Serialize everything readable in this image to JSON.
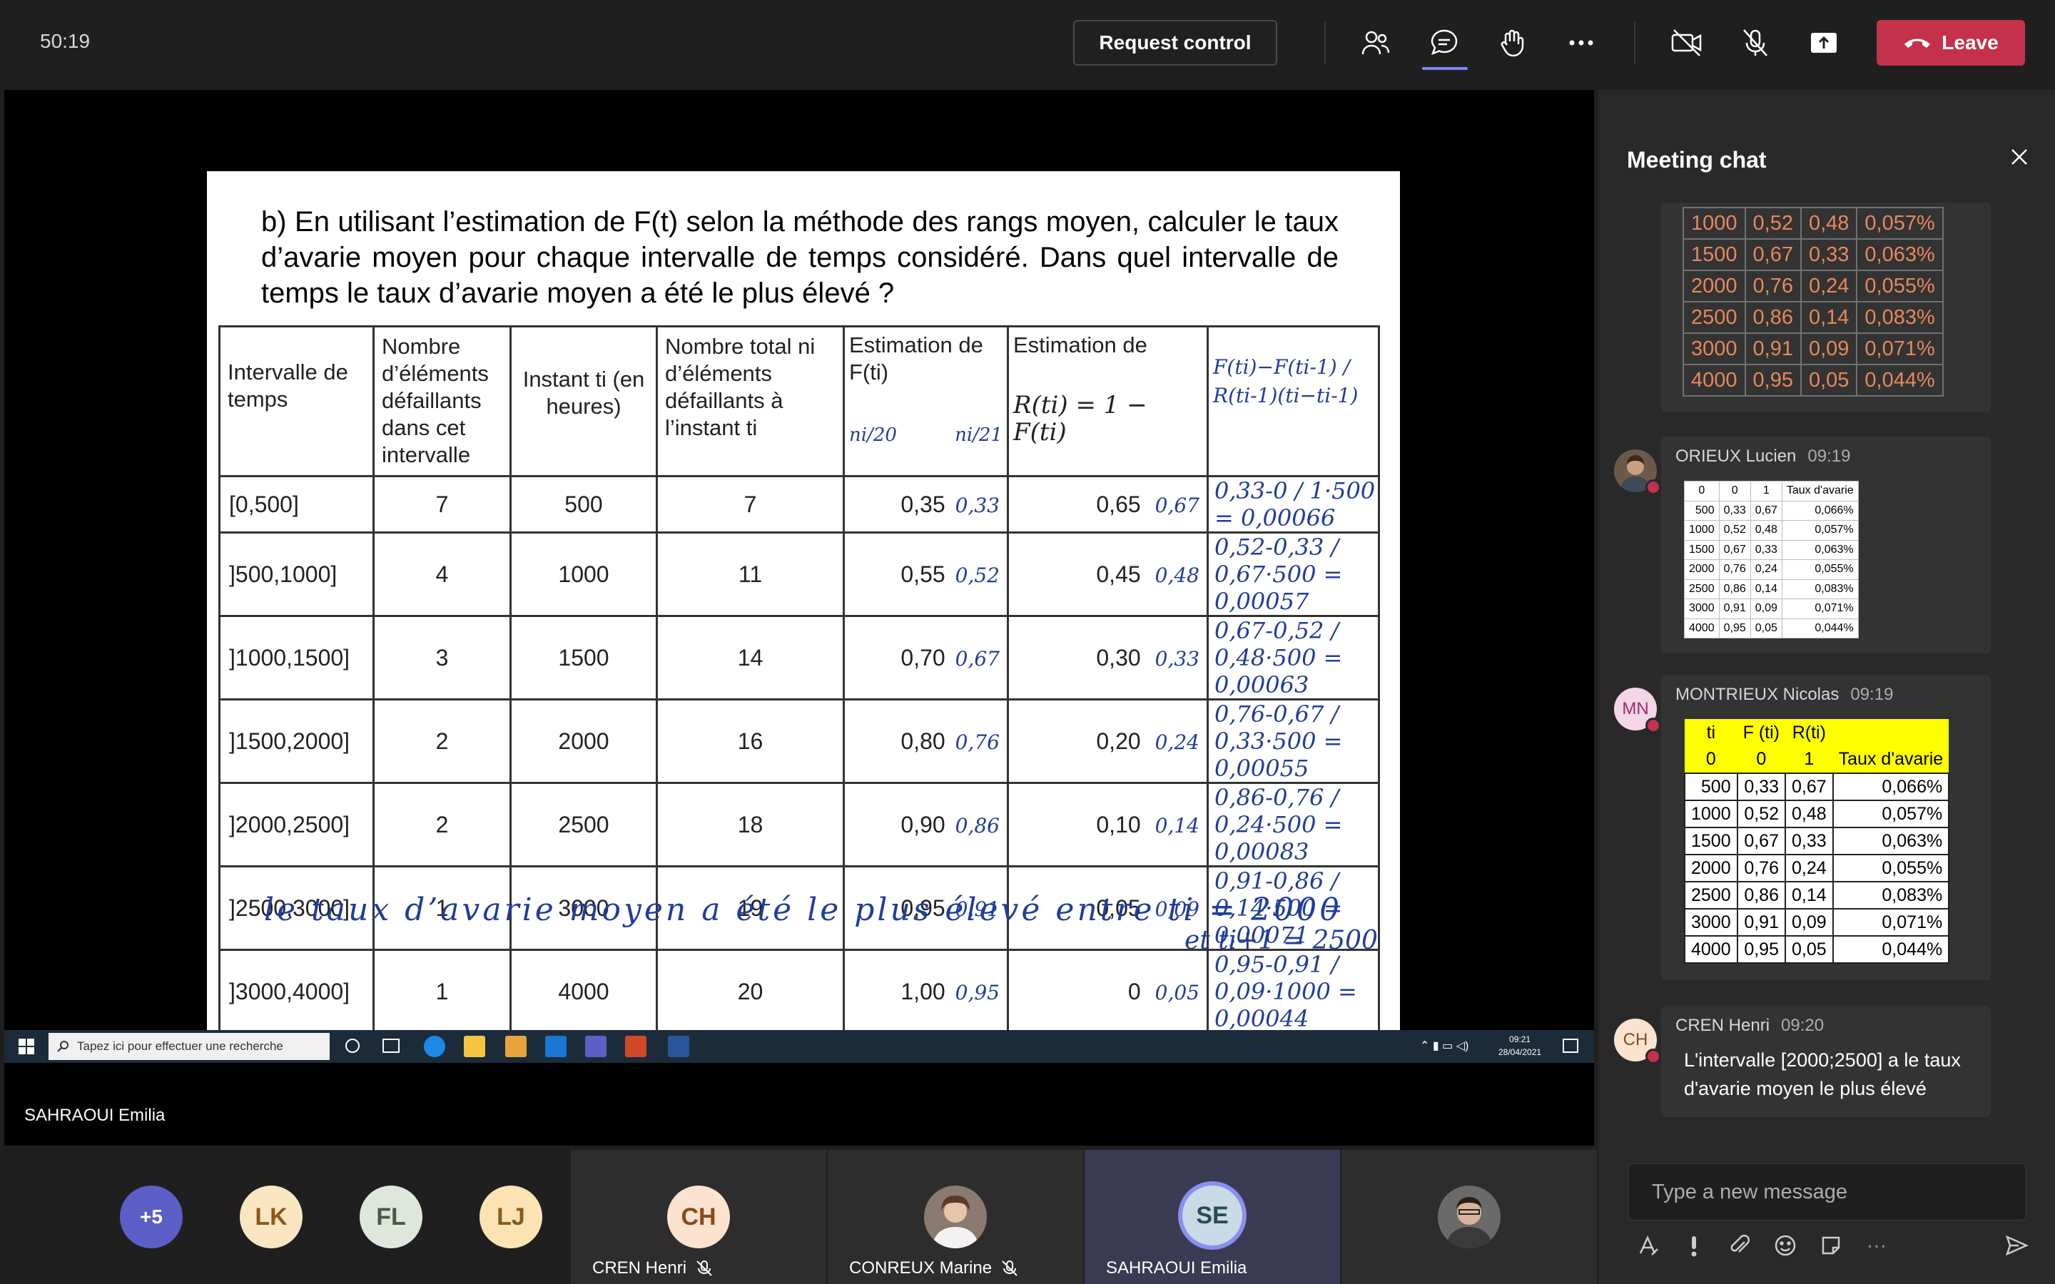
{
  "topbar": {
    "timer": "50:19",
    "request_control": "Request control",
    "leave": "Leave"
  },
  "slide": {
    "question": "b) En utilisant l’estimation de F(t) selon la méthode des rangs moyen, calculer le taux d’avarie moyen pour chaque intervalle de temps considéré. Dans quel intervalle de temps le taux d’avarie moyen a été le plus élevé ?",
    "headers": {
      "interval": "Intervalle de temps",
      "failed": "Nombre d’éléments défaillants dans cet intervalle",
      "instant": "Instant ti (en heures)",
      "total": "Nombre total ni d’éléments défaillants à l’instant ti",
      "f_est": "Estimation de F(ti)",
      "f_hand_a": "ni/20",
      "f_hand_b": "ni/21",
      "r_est": "Estimation de",
      "r_formula": "R(ti) = 1 − F(ti)",
      "hand_formula": "F(ti)−F(ti-1) / R(ti-1)(ti−ti-1)"
    },
    "rows": [
      {
        "interval": "[0,500]",
        "failed": "7",
        "instant": "500",
        "total": "7",
        "f": "0,35",
        "f2": "0,33",
        "r": "0,65",
        "r2": "0,67",
        "rate": "0,33-0 / 1·500 = 0,00066"
      },
      {
        "interval": "]500,1000]",
        "failed": "4",
        "instant": "1000",
        "total": "11",
        "f": "0,55",
        "f2": "0,52",
        "r": "0,45",
        "r2": "0,48",
        "rate": "0,52-0,33 / 0,67·500 = 0,00057"
      },
      {
        "interval": "]1000,1500]",
        "failed": "3",
        "instant": "1500",
        "total": "14",
        "f": "0,70",
        "f2": "0,67",
        "r": "0,30",
        "r2": "0,33",
        "rate": "0,67-0,52 / 0,48·500 = 0,00063"
      },
      {
        "interval": "]1500,2000]",
        "failed": "2",
        "instant": "2000",
        "total": "16",
        "f": "0,80",
        "f2": "0,76",
        "r": "0,20",
        "r2": "0,24",
        "rate": "0,76-0,67 / 0,33·500 = 0,00055"
      },
      {
        "interval": "]2000,2500]",
        "failed": "2",
        "instant": "2500",
        "total": "18",
        "f": "0,90",
        "f2": "0,86",
        "r": "0,10",
        "r2": "0,14",
        "rate": "0,86-0,76 / 0,24·500 = 0,00083"
      },
      {
        "interval": "]2500,3000]",
        "failed": "1",
        "instant": "3000",
        "total": "19",
        "f": "0,95",
        "f2": "0,91",
        "r": "0,05",
        "r2": "0,09",
        "rate": "0,91-0,86 / 0,14·500 = 0,00071"
      },
      {
        "interval": "]3000,4000]",
        "failed": "1",
        "instant": "4000",
        "total": "20",
        "f": "1,00",
        "f2": "0,95",
        "r": "0",
        "r2": "0,05",
        "rate": "0,95-0,91 / 0,09·1000 = 0,00044"
      }
    ],
    "conclusion": "le taux d’avarie moyen a été le plus élevé entre ti = 2000",
    "conclusion2": "et ti+1 = 2500"
  },
  "taskbar": {
    "search": "Tapez ici pour effectuer une recherche",
    "time": "09:21",
    "date": "28/04/2021"
  },
  "presenter": "SAHRAOUI Emilia",
  "chat": {
    "title": "Meeting chat",
    "top_table": [
      [
        "1000",
        "0,52",
        "0,48",
        "0,057%"
      ],
      [
        "1500",
        "0,67",
        "0,33",
        "0,063%"
      ],
      [
        "2000",
        "0,76",
        "0,24",
        "0,055%"
      ],
      [
        "2500",
        "0,86",
        "0,14",
        "0,083%"
      ],
      [
        "3000",
        "0,91",
        "0,09",
        "0,071%"
      ],
      [
        "4000",
        "0,95",
        "0,05",
        "0,044%"
      ]
    ],
    "msg1": {
      "author": "ORIEUX Lucien",
      "time": "09:19",
      "header": [
        "0",
        "0",
        "1",
        "Taux d'avarie"
      ],
      "rows": [
        [
          "500",
          "0,33",
          "0,67",
          "0,066%"
        ],
        [
          "1000",
          "0,52",
          "0,48",
          "0,057%"
        ],
        [
          "1500",
          "0,67",
          "0,33",
          "0,063%"
        ],
        [
          "2000",
          "0,76",
          "0,24",
          "0,055%"
        ],
        [
          "2500",
          "0,86",
          "0,14",
          "0,083%"
        ],
        [
          "3000",
          "0,91",
          "0,09",
          "0,071%"
        ],
        [
          "4000",
          "0,95",
          "0,05",
          "0,044%"
        ]
      ]
    },
    "msg2": {
      "initials": "MN",
      "author": "MONTRIEUX Nicolas",
      "time": "09:19",
      "header1": [
        "ti",
        "F (ti)",
        "R(ti)",
        ""
      ],
      "header2": [
        "0",
        "0",
        "1",
        "Taux d'avarie"
      ],
      "rows": [
        [
          "500",
          "0,33",
          "0,67",
          "0,066%"
        ],
        [
          "1000",
          "0,52",
          "0,48",
          "0,057%"
        ],
        [
          "1500",
          "0,67",
          "0,33",
          "0,063%"
        ],
        [
          "2000",
          "0,76",
          "0,24",
          "0,055%"
        ],
        [
          "2500",
          "0,86",
          "0,14",
          "0,083%"
        ],
        [
          "3000",
          "0,91",
          "0,09",
          "0,071%"
        ],
        [
          "4000",
          "0,95",
          "0,05",
          "0,044%"
        ]
      ]
    },
    "msg3": {
      "initials": "CH",
      "author": "CREN Henri",
      "time": "09:20",
      "text": "L'intervalle [2000;2500] a le taux d'avarie moyen le plus élevé"
    },
    "input_placeholder": "Type a new message"
  },
  "participants": {
    "more": "+5",
    "p1": "LK",
    "p2": "FL",
    "p3": "LJ",
    "p4_initials": "CH",
    "p4_name": "CREN Henri",
    "p5_name": "CONREUX Marine",
    "p6_initials": "SE",
    "p6_name": "SAHRAOUI Emilia"
  },
  "colors": {
    "leave": "#c4314b",
    "accent": "#7f85f5",
    "handwriting": "#1f3d9c",
    "chat_orange": "#e8875c",
    "highlight": "#ffff00"
  }
}
